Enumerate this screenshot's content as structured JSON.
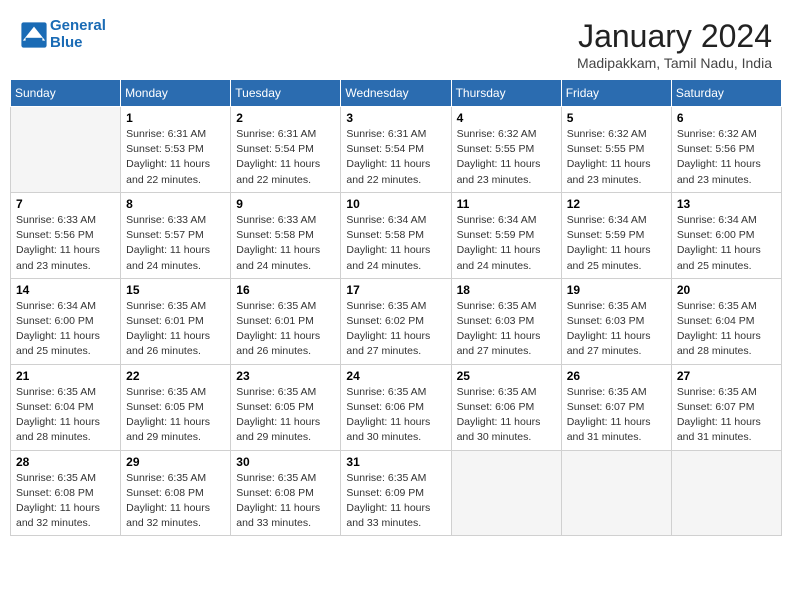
{
  "header": {
    "logo_line1": "General",
    "logo_line2": "Blue",
    "month": "January 2024",
    "location": "Madipakkam, Tamil Nadu, India"
  },
  "weekdays": [
    "Sunday",
    "Monday",
    "Tuesday",
    "Wednesday",
    "Thursday",
    "Friday",
    "Saturday"
  ],
  "weeks": [
    [
      {
        "day": "",
        "empty": true
      },
      {
        "day": "1",
        "sunrise": "6:31 AM",
        "sunset": "5:53 PM",
        "daylight": "11 hours and 22 minutes."
      },
      {
        "day": "2",
        "sunrise": "6:31 AM",
        "sunset": "5:54 PM",
        "daylight": "11 hours and 22 minutes."
      },
      {
        "day": "3",
        "sunrise": "6:31 AM",
        "sunset": "5:54 PM",
        "daylight": "11 hours and 22 minutes."
      },
      {
        "day": "4",
        "sunrise": "6:32 AM",
        "sunset": "5:55 PM",
        "daylight": "11 hours and 23 minutes."
      },
      {
        "day": "5",
        "sunrise": "6:32 AM",
        "sunset": "5:55 PM",
        "daylight": "11 hours and 23 minutes."
      },
      {
        "day": "6",
        "sunrise": "6:32 AM",
        "sunset": "5:56 PM",
        "daylight": "11 hours and 23 minutes."
      }
    ],
    [
      {
        "day": "7",
        "sunrise": "6:33 AM",
        "sunset": "5:56 PM",
        "daylight": "11 hours and 23 minutes."
      },
      {
        "day": "8",
        "sunrise": "6:33 AM",
        "sunset": "5:57 PM",
        "daylight": "11 hours and 24 minutes."
      },
      {
        "day": "9",
        "sunrise": "6:33 AM",
        "sunset": "5:58 PM",
        "daylight": "11 hours and 24 minutes."
      },
      {
        "day": "10",
        "sunrise": "6:34 AM",
        "sunset": "5:58 PM",
        "daylight": "11 hours and 24 minutes."
      },
      {
        "day": "11",
        "sunrise": "6:34 AM",
        "sunset": "5:59 PM",
        "daylight": "11 hours and 24 minutes."
      },
      {
        "day": "12",
        "sunrise": "6:34 AM",
        "sunset": "5:59 PM",
        "daylight": "11 hours and 25 minutes."
      },
      {
        "day": "13",
        "sunrise": "6:34 AM",
        "sunset": "6:00 PM",
        "daylight": "11 hours and 25 minutes."
      }
    ],
    [
      {
        "day": "14",
        "sunrise": "6:34 AM",
        "sunset": "6:00 PM",
        "daylight": "11 hours and 25 minutes."
      },
      {
        "day": "15",
        "sunrise": "6:35 AM",
        "sunset": "6:01 PM",
        "daylight": "11 hours and 26 minutes."
      },
      {
        "day": "16",
        "sunrise": "6:35 AM",
        "sunset": "6:01 PM",
        "daylight": "11 hours and 26 minutes."
      },
      {
        "day": "17",
        "sunrise": "6:35 AM",
        "sunset": "6:02 PM",
        "daylight": "11 hours and 27 minutes."
      },
      {
        "day": "18",
        "sunrise": "6:35 AM",
        "sunset": "6:03 PM",
        "daylight": "11 hours and 27 minutes."
      },
      {
        "day": "19",
        "sunrise": "6:35 AM",
        "sunset": "6:03 PM",
        "daylight": "11 hours and 27 minutes."
      },
      {
        "day": "20",
        "sunrise": "6:35 AM",
        "sunset": "6:04 PM",
        "daylight": "11 hours and 28 minutes."
      }
    ],
    [
      {
        "day": "21",
        "sunrise": "6:35 AM",
        "sunset": "6:04 PM",
        "daylight": "11 hours and 28 minutes."
      },
      {
        "day": "22",
        "sunrise": "6:35 AM",
        "sunset": "6:05 PM",
        "daylight": "11 hours and 29 minutes."
      },
      {
        "day": "23",
        "sunrise": "6:35 AM",
        "sunset": "6:05 PM",
        "daylight": "11 hours and 29 minutes."
      },
      {
        "day": "24",
        "sunrise": "6:35 AM",
        "sunset": "6:06 PM",
        "daylight": "11 hours and 30 minutes."
      },
      {
        "day": "25",
        "sunrise": "6:35 AM",
        "sunset": "6:06 PM",
        "daylight": "11 hours and 30 minutes."
      },
      {
        "day": "26",
        "sunrise": "6:35 AM",
        "sunset": "6:07 PM",
        "daylight": "11 hours and 31 minutes."
      },
      {
        "day": "27",
        "sunrise": "6:35 AM",
        "sunset": "6:07 PM",
        "daylight": "11 hours and 31 minutes."
      }
    ],
    [
      {
        "day": "28",
        "sunrise": "6:35 AM",
        "sunset": "6:08 PM",
        "daylight": "11 hours and 32 minutes."
      },
      {
        "day": "29",
        "sunrise": "6:35 AM",
        "sunset": "6:08 PM",
        "daylight": "11 hours and 32 minutes."
      },
      {
        "day": "30",
        "sunrise": "6:35 AM",
        "sunset": "6:08 PM",
        "daylight": "11 hours and 33 minutes."
      },
      {
        "day": "31",
        "sunrise": "6:35 AM",
        "sunset": "6:09 PM",
        "daylight": "11 hours and 33 minutes."
      },
      {
        "day": "",
        "empty": true
      },
      {
        "day": "",
        "empty": true
      },
      {
        "day": "",
        "empty": true
      }
    ]
  ]
}
